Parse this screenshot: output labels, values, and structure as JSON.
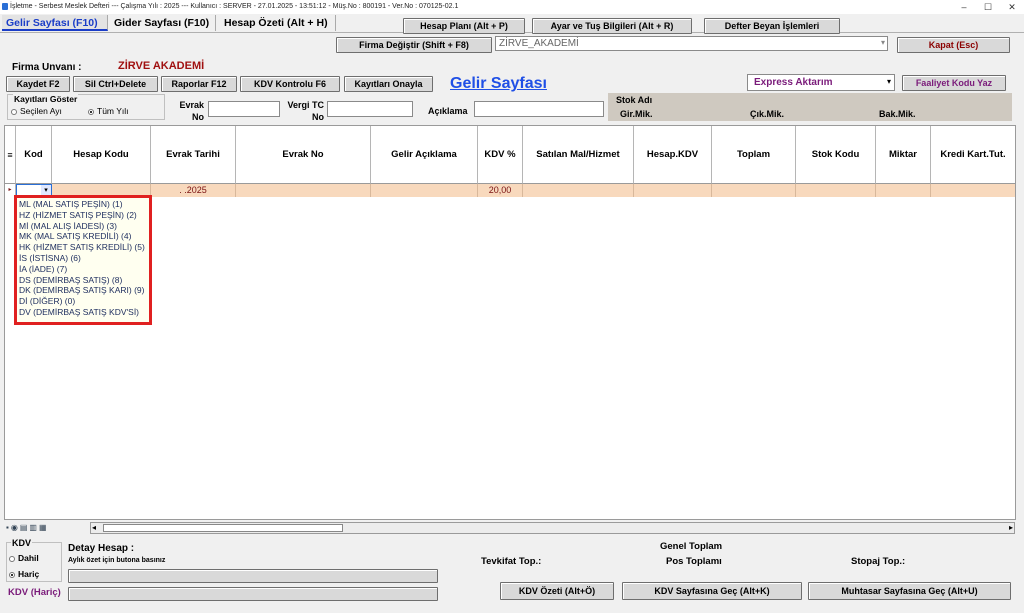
{
  "titlebar": {
    "text": "İşletme - Serbest Meslek Defteri  ---  Çalışma Yılı : 2025  ---  Kullanıcı : SERVER - 27.01.2025 - 13:51:12 - Müş.No : 800191 - Ver.No : 070125-02.1",
    "minimize": "–",
    "maximize": "☐",
    "close": "✕"
  },
  "tabs": [
    "Gelir Sayfası (F10)",
    "Gider Sayfası (F10)",
    "Hesap Özeti (Alt + H)"
  ],
  "top_buttons": {
    "hesap_plani": "Hesap Planı (Alt + P)",
    "ayar": "Ayar ve Tuş Bilgileri (Alt + R)",
    "defter_beyan": "Defter Beyan İşlemleri",
    "firma_degistir": "Firma Değiştir (Shift + F8)",
    "kapat": "Kapat (Esc)"
  },
  "firma": {
    "combo_value": "ZİRVE_AKADEMİ",
    "unvan_label": "Firma Unvanı :",
    "unvan_value": "ZİRVE AKADEMİ"
  },
  "toolbar": {
    "kaydet": "Kaydet F2",
    "sil": "Sil Ctrl+Delete",
    "raporlar": "Raporlar F12",
    "kdv_kontrolu": "KDV Kontrolu F6",
    "kayitlari_onayla": "Kayıtları Onayla"
  },
  "page_title": "Gelir Sayfası",
  "express": {
    "value": "Express Aktarım",
    "faaliyet": "Faaliyet Kodu Yaz"
  },
  "filter": {
    "group_label": "Kayıtları Göster",
    "secilen_ayi": "Seçilen Ayı",
    "tum_yil": "Tüm Yılı",
    "evrak_no_label": "Evrak\nNo",
    "vergi_tc_label": "Vergi TC\nNo",
    "aciklama_label": "Açıklama"
  },
  "stok": {
    "adi": "Stok Adı",
    "gir": "Gir.Mik.",
    "cik": "Çık.Mik.",
    "bak": "Bak.Mik."
  },
  "grid": {
    "columns": [
      "Kod",
      "Hesap Kodu",
      "Evrak Tarihi",
      "Evrak No",
      "Gelir Açıklama",
      "KDV %",
      "Satılan Mal/Hizmet",
      "Hesap.KDV",
      "Toplam",
      "Stok Kodu",
      "Miktar",
      "Kredi Kart.Tut."
    ],
    "row": {
      "evrak_tarihi": ".  .2025",
      "kdv": "20,00"
    }
  },
  "kod_options": [
    "ML (MAL SATIŞ PEŞİN) (1)",
    "HZ (HİZMET SATIŞ PEŞİN) (2)",
    "Mİ (MAL ALIŞ İADESİ) (3)",
    "MK (MAL SATIŞ KREDİLİ) (4)",
    "HK (HİZMET SATIŞ KREDİLİ) (5)",
    "İS (İSTİSNA) (6)",
    "İA (İADE) (7)",
    "DS (DEMİRBAŞ SATIŞ) (8)",
    "DK (DEMİRBAŞ SATIŞ KARI) (9)",
    "Dİ (DİĞER) (0)",
    "DV (DEMİRBAŞ SATIŞ KDV'Sİ)"
  ],
  "bottom": {
    "kdv_label": "KDV",
    "dahil": "Dahil",
    "haric": "Hariç",
    "kdv_haric": "KDV (Hariç)",
    "detay_hesap": "Detay Hesap :",
    "detay_hint": "Aylık özet için butona basınız",
    "genel_toplam": "Genel Toplam",
    "tevkifat": "Tevkifat  Top.:",
    "pos": "Pos Toplamı",
    "stopaj": "Stopaj  Top.:",
    "kdv_ozeti": "KDV Özeti (Alt+Ö)",
    "kdv_sayfasina": "KDV Sayfasına Geç (Alt+K)",
    "muhtasar": "Muhtasar Sayfasına Geç (Alt+U)"
  }
}
